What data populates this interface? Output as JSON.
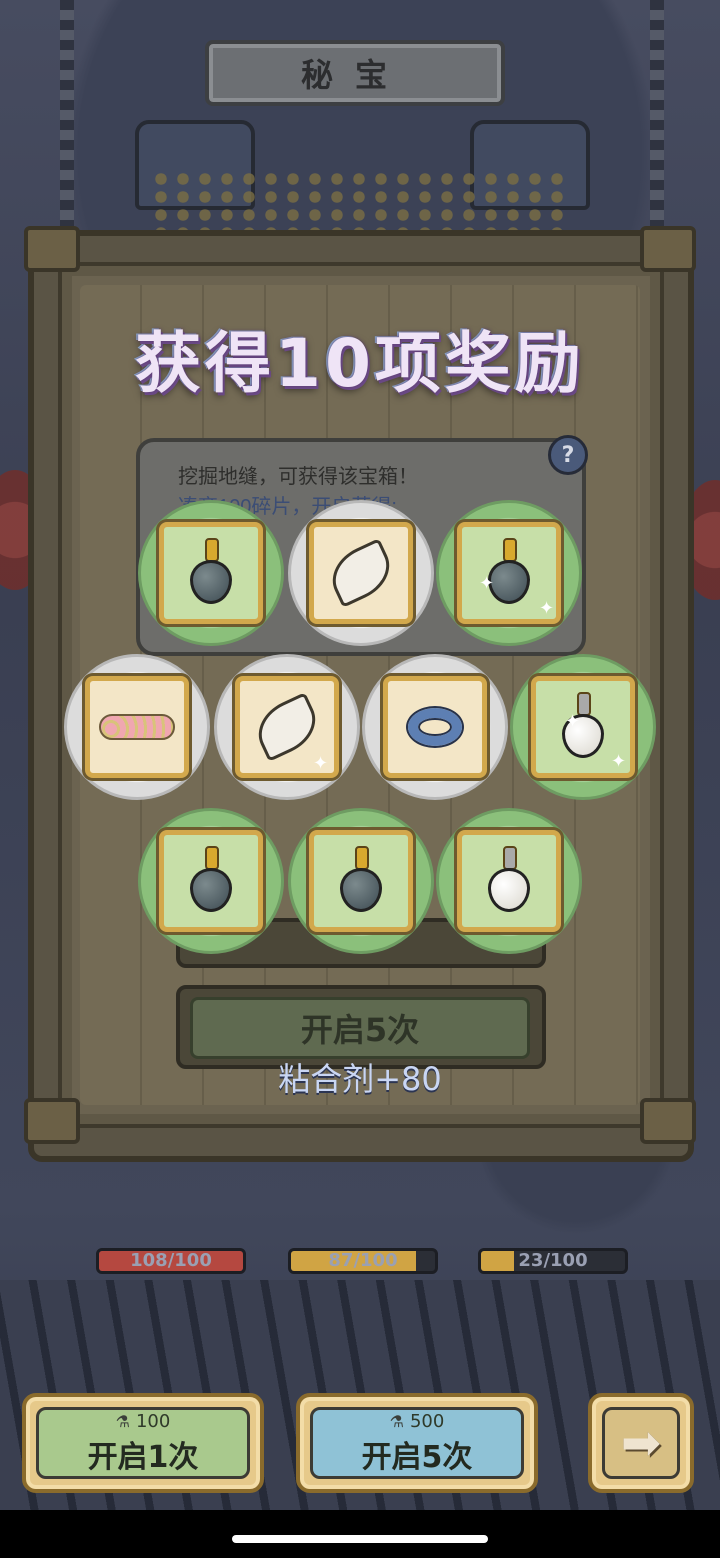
{
  "header": {
    "title": "秘宝"
  },
  "popup": {
    "title": "获得10项奖励",
    "hint_line1": "挖掘地缝，可获得该宝箱！",
    "hint_line2": "凑齐100碎片，开启获得:",
    "help_symbol": "?",
    "open_button_label": "开启5次",
    "reward_text": "粘合剂+80"
  },
  "rewards": [
    {
      "item": "pendant-black-pearl",
      "rarity": "green"
    },
    {
      "item": "tooth-fang",
      "rarity": "white"
    },
    {
      "item": "pendant-black-pearl",
      "rarity": "green"
    },
    {
      "item": "flower-wreath",
      "rarity": "white"
    },
    {
      "item": "tooth-fang",
      "rarity": "white"
    },
    {
      "item": "blue-ring",
      "rarity": "white"
    },
    {
      "item": "pendant-white-pearl",
      "rarity": "green"
    },
    {
      "item": "pendant-black-pearl",
      "rarity": "green"
    },
    {
      "item": "pendant-black-pearl",
      "rarity": "green"
    },
    {
      "item": "pendant-white-pearl",
      "rarity": "green"
    }
  ],
  "progress": [
    {
      "text": "108/100",
      "value": 1.0,
      "color": "#b54840"
    },
    {
      "text": "87/100",
      "value": 0.87,
      "color": "#d0a444"
    },
    {
      "text": "23/100",
      "value": 0.23,
      "color": "#d0a444"
    }
  ],
  "bottom": {
    "open1": {
      "cost": "100",
      "label": "开启1次",
      "color": "#a9c98d"
    },
    "open5": {
      "cost": "500",
      "label": "开启5次",
      "color": "#8fc2d6"
    },
    "next_icon": "arrow-right-icon"
  },
  "colors": {
    "title_glow": "#6b4a86",
    "reward_text": "#c9d6f4"
  }
}
